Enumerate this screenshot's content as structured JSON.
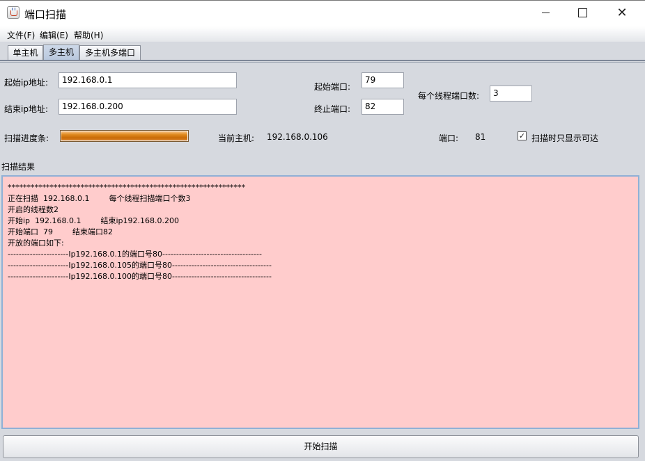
{
  "window": {
    "title": "端口扫描",
    "icon": "java-coffee-icon",
    "controls": {
      "minimize": "minimize-icon",
      "maximize": "maximize-icon",
      "close": "✕"
    }
  },
  "menubar": {
    "items": [
      "文件(F)",
      "编辑(E)",
      "帮助(H)"
    ]
  },
  "tabs": [
    {
      "label": "单主机",
      "active": false
    },
    {
      "label": "多主机",
      "active": true
    },
    {
      "label": "多主机多端口",
      "active": false
    }
  ],
  "form": {
    "start_ip_label": "起始ip地址:",
    "start_ip_value": "192.168.0.1",
    "end_ip_label": "结束ip地址:",
    "end_ip_value": "192.168.0.200",
    "start_port_label": "起始端口:",
    "start_port_value": "79",
    "end_port_label": "终止端口:",
    "end_port_value": "82",
    "threads_label": "每个线程端口数:",
    "threads_value": "3"
  },
  "status": {
    "progress_label": "扫描进度条:",
    "progress_fraction": 1.0,
    "current_host_label": "当前主机:",
    "current_host_value": "192.168.0.106",
    "port_label": "端口:",
    "port_value": "81",
    "show_reachable_label": "扫描时只显示可达",
    "show_reachable_checked": true
  },
  "results": {
    "section_label": "扫描结果",
    "lines": [
      "**************************************************************",
      "正在扫描  192.168.0.1        每个线程扫描端口个数3",
      "开启的线程数2",
      "开始ip  192.168.0.1        结束ip192.168.0.200",
      "开始端口  79        结束端口82",
      "开放的端口如下:",
      "----------------------Ip192.168.0.1的端口号80------------------------------------",
      "----------------------Ip192.168.0.105的端口号80------------------------------------",
      "----------------------Ip192.168.0.100的端口号80------------------------------------"
    ]
  },
  "actions": {
    "start_scan_label": "开始扫描"
  },
  "colors": {
    "window_bg": "#d6d9df",
    "results_bg": "#ffcccc",
    "progress_fill": "#d47614"
  }
}
